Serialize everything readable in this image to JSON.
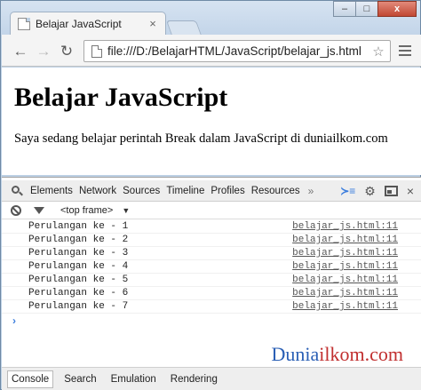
{
  "browser": {
    "tab_title": "Belajar JavaScript",
    "tab_close_glyph": "×",
    "window_controls": {
      "minimize": "–",
      "maximize": "□",
      "close": "x"
    },
    "nav": {
      "back": "←",
      "forward": "→",
      "reload": "↻"
    },
    "url": "file:///D:/BelajarHTML/JavaScript/belajar_js.html",
    "star_glyph": "☆"
  },
  "page": {
    "heading": "Belajar JavaScript",
    "paragraph": "Saya sedang belajar perintah Break dalam JavaScript di duniailkom.com"
  },
  "devtools": {
    "tabs": [
      "Elements",
      "Network",
      "Sources",
      "Timeline",
      "Profiles",
      "Resources"
    ],
    "more_glyph": "»",
    "right_icons": {
      "console_drawer": "≻≡",
      "settings": "⚙",
      "close": "×"
    },
    "frame_select": "<top frame>",
    "frame_caret": "▼",
    "console_rows": [
      {
        "message": "Perulangan ke - 1",
        "source": "belajar_js.html:11"
      },
      {
        "message": "Perulangan ke - 2",
        "source": "belajar_js.html:11"
      },
      {
        "message": "Perulangan ke - 3",
        "source": "belajar_js.html:11"
      },
      {
        "message": "Perulangan ke - 4",
        "source": "belajar_js.html:11"
      },
      {
        "message": "Perulangan ke - 5",
        "source": "belajar_js.html:11"
      },
      {
        "message": "Perulangan ke - 6",
        "source": "belajar_js.html:11"
      },
      {
        "message": "Perulangan ke - 7",
        "source": "belajar_js.html:11"
      }
    ],
    "prompt_glyph": "›",
    "drawer_tabs": [
      "Console",
      "Search",
      "Emulation",
      "Rendering"
    ],
    "active_drawer_tab": "Console"
  },
  "watermark": {
    "part1": "Dunia",
    "part2": "ilkom.com"
  },
  "colors": {
    "watermark_blue": "#2a5fb5",
    "watermark_red": "#c12f2f",
    "prompt_blue": "#3b7ddd"
  }
}
